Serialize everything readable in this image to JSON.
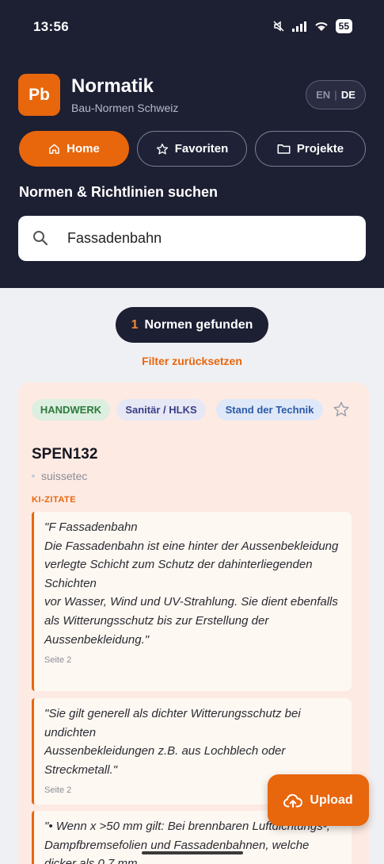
{
  "status_bar": {
    "time": "13:56",
    "battery": "55"
  },
  "app": {
    "logo_text": "Pb",
    "title": "Normatik",
    "subtitle": "Bau-Normen Schweiz"
  },
  "language": {
    "en": "EN",
    "separator": "|",
    "de": "DE",
    "active": "DE"
  },
  "nav": [
    {
      "label": "Home",
      "icon": "home-icon",
      "active": true
    },
    {
      "label": "Favoriten",
      "icon": "star-icon",
      "active": false
    },
    {
      "label": "Projekte",
      "icon": "folder-icon",
      "active": false
    }
  ],
  "search": {
    "heading": "Normen & Richtlinien suchen",
    "value": "Fassadenbahn",
    "icon": "search-icon"
  },
  "results": {
    "count": "1",
    "label": "Normen gefunden",
    "filter_reset": "Filter zurücksetzen"
  },
  "card": {
    "tags": [
      "HANDWERK",
      "Sanitär / HLKS",
      "Stand der Technik"
    ],
    "code": "SPEN132",
    "organization": "suissetec",
    "ai_quotes_label": "KI-ZITATE",
    "quotes": [
      {
        "text": "\"F Fassadenbahn\n Die Fassadenbahn ist eine hinter der Aussenbekleidung\nverlegte Schicht zum Schutz der dahinterliegenden Schichten\nvor Wasser, Wind und UV-Strahlung. Sie dient ebenfalls als Witterungsschutz bis zur Erstellung der Aussenbekleidung.\"",
        "page": "Seite 2"
      },
      {
        "text": "\"Sie gilt generell als dichter Witterungsschutz bei undichten\nAussenbekleidungen z.B. aus Lochblech oder Streckmetall.\"",
        "page": "Seite 2"
      },
      {
        "text": "\"• Wenn x >50 mm gilt: Bei brennbaren Luftdichtungs-, Dampfbremsefolien und Fassadenbahnen, welche dicker als 0.7 mm",
        "page": ""
      }
    ]
  },
  "upload": {
    "label": "Upload",
    "icon": "cloud-upload-icon"
  },
  "colors": {
    "accent": "#e8660c",
    "header_bg": "#1d1f33",
    "card_bg": "#fdeae3"
  }
}
